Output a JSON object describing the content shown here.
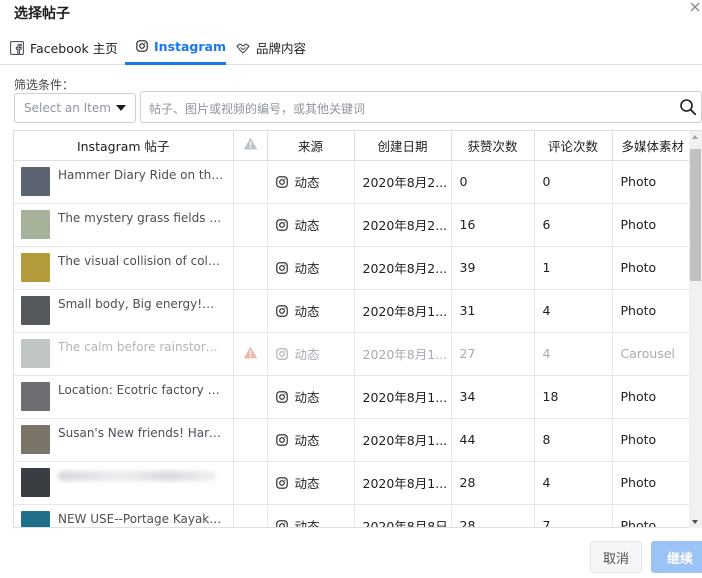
{
  "dialog": {
    "title": "选择帖子"
  },
  "tabs": [
    {
      "label": "Facebook 主页",
      "icon": "facebook-icon"
    },
    {
      "label": "Instagram",
      "icon": "instagram-icon",
      "active": true
    },
    {
      "label": "品牌内容",
      "icon": "handshake-icon"
    }
  ],
  "filter": {
    "label": "筛选条件：",
    "select_placeholder": "Select an Item",
    "search_placeholder": "帖子、图片或视频的编号，或其他关键词"
  },
  "table": {
    "headers": [
      "Instagram 帖子",
      "",
      "来源",
      "创建日期",
      "获赞次数",
      "评论次数",
      "多媒体素材"
    ],
    "rows": [
      {
        "title": "Hammer Diary Ride on the beach",
        "source": "动态",
        "date": "2020年8月2...",
        "likes": "0",
        "comments": "0",
        "media": "Photo",
        "thumb": "#5b6470"
      },
      {
        "title": "The mystery grass fields may hide",
        "source": "动态",
        "date": "2020年8月2...",
        "likes": "16",
        "comments": "6",
        "media": "Photo",
        "thumb": "#a7b29a"
      },
      {
        "title": "The visual collision of colors, yes",
        "source": "动态",
        "date": "2020年8月2...",
        "likes": "39",
        "comments": "1",
        "media": "Photo",
        "thumb": "#b39a3a"
      },
      {
        "title": "Small body, Big energy!🚲 📷",
        "source": "动态",
        "date": "2020年8月1...",
        "likes": "31",
        "comments": "4",
        "media": "Photo",
        "thumb": "#55595e"
      },
      {
        "title": "The calm before rainstorm. Here",
        "source": "动态",
        "date": "2020年8月1...",
        "likes": "27",
        "comments": "4",
        "media": "Carousel",
        "thumb": "#8c9990",
        "dim": true,
        "warning": true
      },
      {
        "title": "Location: Ecotric factory A supply",
        "source": "动态",
        "date": "2020年8月1...",
        "likes": "34",
        "comments": "18",
        "media": "Photo",
        "thumb": "#6d6f73"
      },
      {
        "title": "Susan's New friends! Harold and",
        "source": "动态",
        "date": "2020年8月1...",
        "likes": "44",
        "comments": "8",
        "media": "Photo",
        "thumb": "#7b7468"
      },
      {
        "title": "",
        "source": "动态",
        "date": "2020年8月1...",
        "likes": "28",
        "comments": "4",
        "media": "Photo",
        "thumb": "#3a3d42",
        "blurred": true
      },
      {
        "title": "NEW USE--Portage Kayaks!!! Why",
        "source": "动态",
        "date": "2020年8月8日",
        "likes": "28",
        "comments": "7",
        "media": "Photo",
        "thumb": "#1f6f8b"
      }
    ]
  },
  "footer": {
    "cancel_label": "取消",
    "next_label": "继续"
  },
  "colors": {
    "accent": "#1877f2",
    "border": "#dddfe2",
    "warning": "#f0b7aa"
  }
}
